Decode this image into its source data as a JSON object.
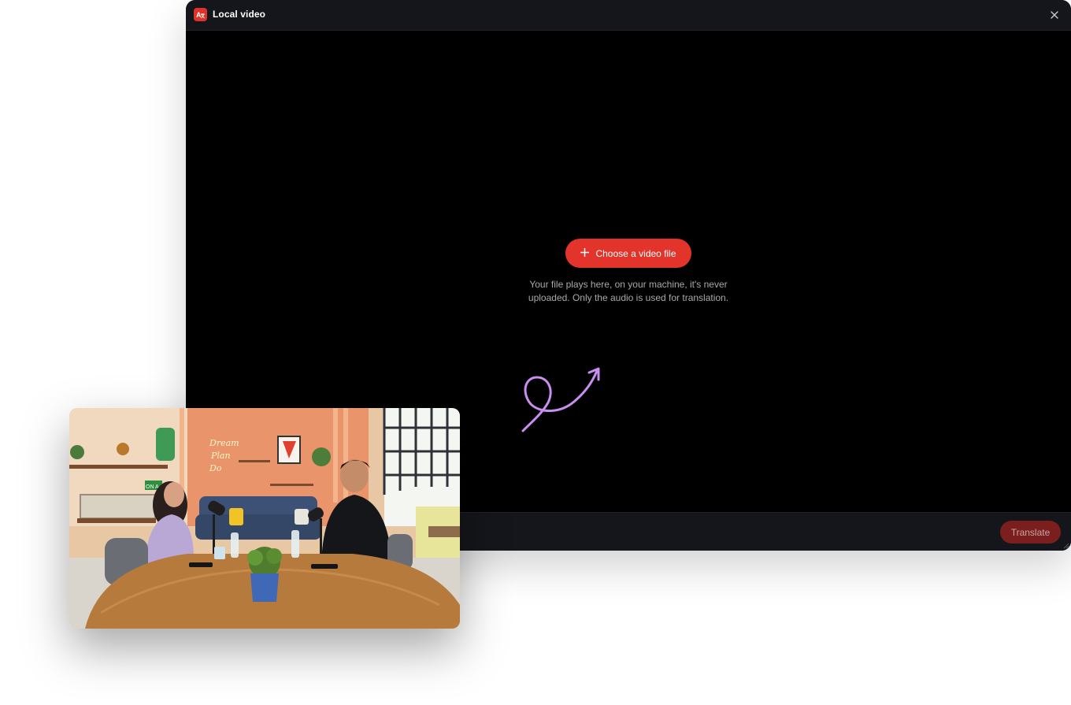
{
  "window": {
    "title": "Local video",
    "app_icon": "translate-app-icon",
    "close_icon": "close-icon"
  },
  "content": {
    "choose_button_label": "Choose a video file",
    "choose_button_icon": "plus-icon",
    "helper_line_1": "Your file plays here, on your machine, it's never",
    "helper_line_2": "uploaded. Only the audio is used for translation."
  },
  "footer": {
    "translate_label": "Translate"
  },
  "preview": {
    "neon_sign_line_1": "Dream",
    "neon_sign_line_2": "Plan",
    "neon_sign_line_3": "Do",
    "on_air_sign": "ON A"
  },
  "colors": {
    "accent": "#e3342b",
    "accent_disabled": "#7a1f1d",
    "doodle": "#c88ef0",
    "titlebar": "#15161b"
  }
}
